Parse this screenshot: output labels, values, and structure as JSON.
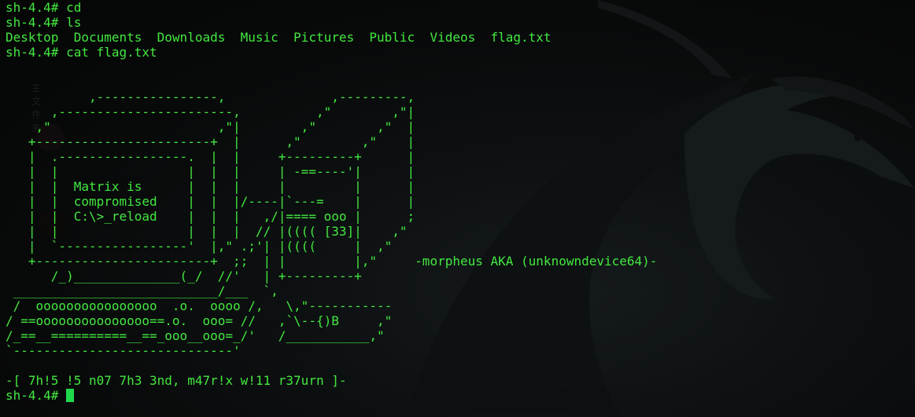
{
  "desktop": {
    "ghost_label_top": "主文件夹"
  },
  "terminal": {
    "prompt": "sh-4.4#",
    "lines": [
      "sh-4.4# cd",
      "sh-4.4# ls",
      "Desktop  Documents  Downloads  Music  Pictures  Public  Videos  flag.txt",
      "sh-4.4# cat flag.txt",
      "",
      "",
      "           ,----------------,              ,---------,",
      "      ,-----------------------,          ,\"        ,\"|",
      "    ,\"                      ,\"|        ,\"        ,\"  |",
      "   +-----------------------+  |      ,\"        ,\"    |",
      "   |  .-----------------.  |  |     +---------+      |",
      "   |  |                 |  |  |     | -==----'|      |",
      "   |  |  Matrix is      |  |  |     |         |      |",
      "   |  |  compromised    |  |  |/----|`---=    |      |",
      "   |  |  C:\\>_reload    |  |  |   ,/|==== ooo |      ;",
      "   |  |                 |  |  |  // |(((( [33]|    ,\"",
      "   |  `-----------------'  |,\" .;'| |((((     |  ,\"",
      "   +-----------------------+  ;;  | |         |,\"     -morpheus AKA (unknowndevice64)-",
      "      /_)______________(_/  //'   | +---------+",
      " ___________________________/___  `,",
      " /  oooooooooooooooo  .o.  oooo /,   \\,\"-----------",
      "/ ==ooooooooooooooo==.o.  ooo= //   ,`\\--{)B     ,\"",
      "/_==__==========__==_ooo__ooo=_/'   /___________,\"",
      "`-----------------------------'",
      "",
      "-[ 7h!5 !5 n07 7h3 3nd, m47r!x w!11 r37urn ]-"
    ],
    "current_prompt": "sh-4.4# "
  },
  "theme": {
    "text_color": "#43e840",
    "cursor_color": "#1fd84a",
    "background": "#050606"
  }
}
